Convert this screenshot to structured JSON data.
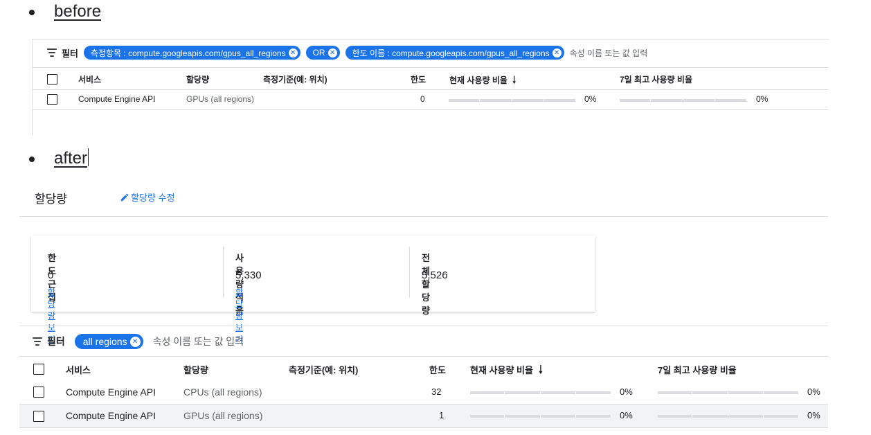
{
  "before": {
    "label": "before",
    "filter_label": "필터",
    "chips": [
      {
        "label": "측정항목 : compute.googleapis.com/gpus_all_regions"
      },
      {
        "label": "OR"
      },
      {
        "label": "한도 이름 : compute.googleapis.com/gpus_all_regions"
      }
    ],
    "filter_placeholder": "속성 이름 또는 값 입력",
    "columns": [
      "서비스",
      "할당량",
      "측정기준(예: 위치)",
      "한도",
      "현재 사용량 비율",
      "7일 최고 사용량 비율"
    ],
    "sort_icon": "arrow-down-icon",
    "rows": [
      {
        "service": "Compute Engine API",
        "quota": "GPUs (all regions)",
        "dimension": "",
        "limit": "0",
        "current_pct": "0%",
        "peak_pct": "0%"
      }
    ]
  },
  "after": {
    "label": "after",
    "page_title": "할당량",
    "edit_label": "할당량 수정",
    "cards": [
      {
        "title": "한도 근접",
        "value": "0",
        "link": "할당량 보기"
      },
      {
        "title": "사용량 적음",
        "value": "5,330",
        "link": "할당량 보기"
      },
      {
        "title": "전체 할당량",
        "value": "5,526"
      }
    ],
    "filter_label": "필터",
    "chips": [
      {
        "label": "all regions"
      }
    ],
    "filter_placeholder": "속성 이름 또는 값 입력",
    "columns": [
      "서비스",
      "할당량",
      "측정기준(예: 위치)",
      "한도",
      "현재 사용량 비율",
      "7일 최고 사용량 비율"
    ],
    "rows": [
      {
        "service": "Compute Engine API",
        "quota": "CPUs (all regions)",
        "dimension": "",
        "limit": "32",
        "current_pct": "0%",
        "peak_pct": "0%"
      },
      {
        "service": "Compute Engine API",
        "quota": "GPUs (all regions)",
        "dimension": "",
        "limit": "1",
        "current_pct": "0%",
        "peak_pct": "0%"
      }
    ]
  },
  "colors": {
    "accent": "#1a73e8",
    "divider": "#dadce0",
    "row_hover": "#f1f3f4"
  }
}
